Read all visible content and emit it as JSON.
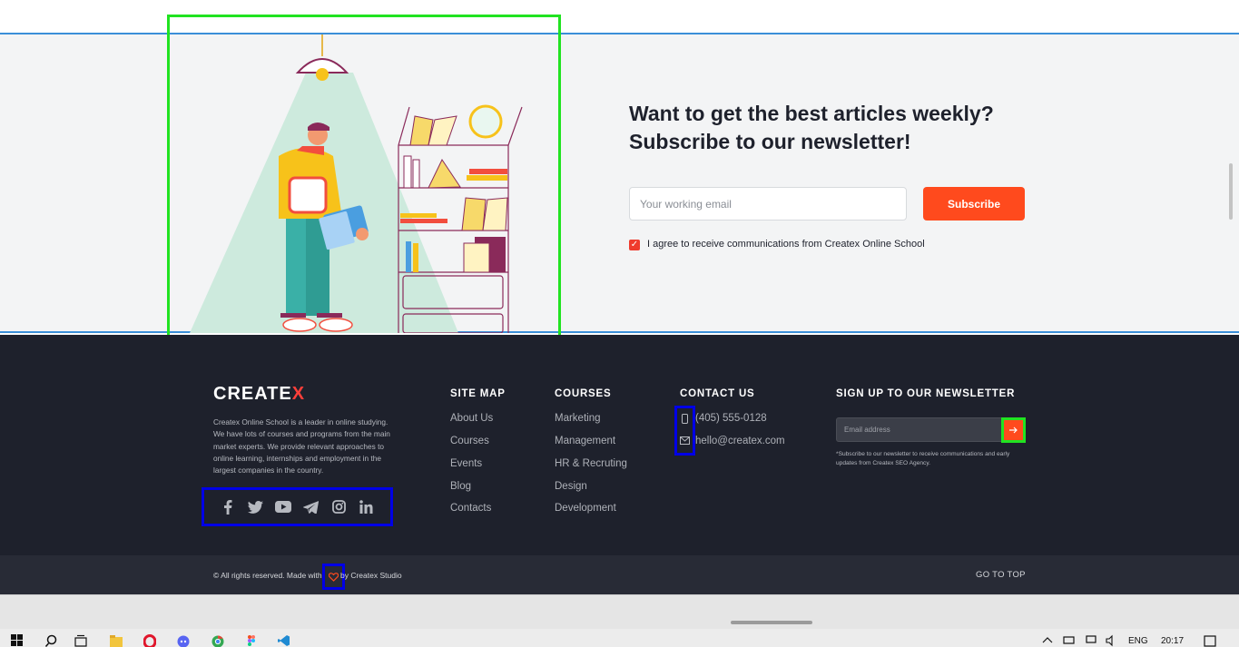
{
  "newsletter": {
    "title_line1": "Want to get the best articles weekly?",
    "title_line2": "Subscribe to our newsletter!",
    "email_placeholder": "Your working email",
    "subscribe_label": "Subscribe",
    "agree_text": "I agree to receive communications from Createx Online School",
    "agree_checked": true
  },
  "footer": {
    "logo_main": "CREATE",
    "logo_accent": "X",
    "about": "Createx Online School is a leader in online studying. We have lots of courses and programs from the main market experts. We provide relevant approaches to online learning, internships and employment in the largest companies in the country.",
    "social": [
      "facebook-icon",
      "twitter-icon",
      "youtube-icon",
      "telegram-icon",
      "instagram-icon",
      "linkedin-icon"
    ],
    "site_map": {
      "heading": "SITE MAP",
      "links": [
        "About Us",
        "Courses",
        "Events",
        "Blog",
        "Contacts"
      ]
    },
    "courses": {
      "heading": "COURSES",
      "links": [
        "Marketing",
        "Management",
        "HR & Recruting",
        "Design",
        "Development"
      ]
    },
    "contact": {
      "heading": "CONTACT US",
      "phone": "(405) 555-0128",
      "email": "hello@createx.com"
    },
    "newsletter": {
      "heading": "SIGN UP TO OUR NEWSLETTER",
      "placeholder": "Email address",
      "note": "*Subscribe to our newsletter to receive communications and early updates from Createx SEO Agency."
    },
    "copyright_a": "© All rights reserved. Made with",
    "copyright_b": "by Createx Studio",
    "go_to_top": "GO TO TOP"
  },
  "taskbar": {
    "lang": "ENG",
    "time": "20:17"
  },
  "colors": {
    "accent": "#ff4a1d",
    "footer_bg": "#1e212c",
    "band_bg": "#f3f4f5"
  }
}
